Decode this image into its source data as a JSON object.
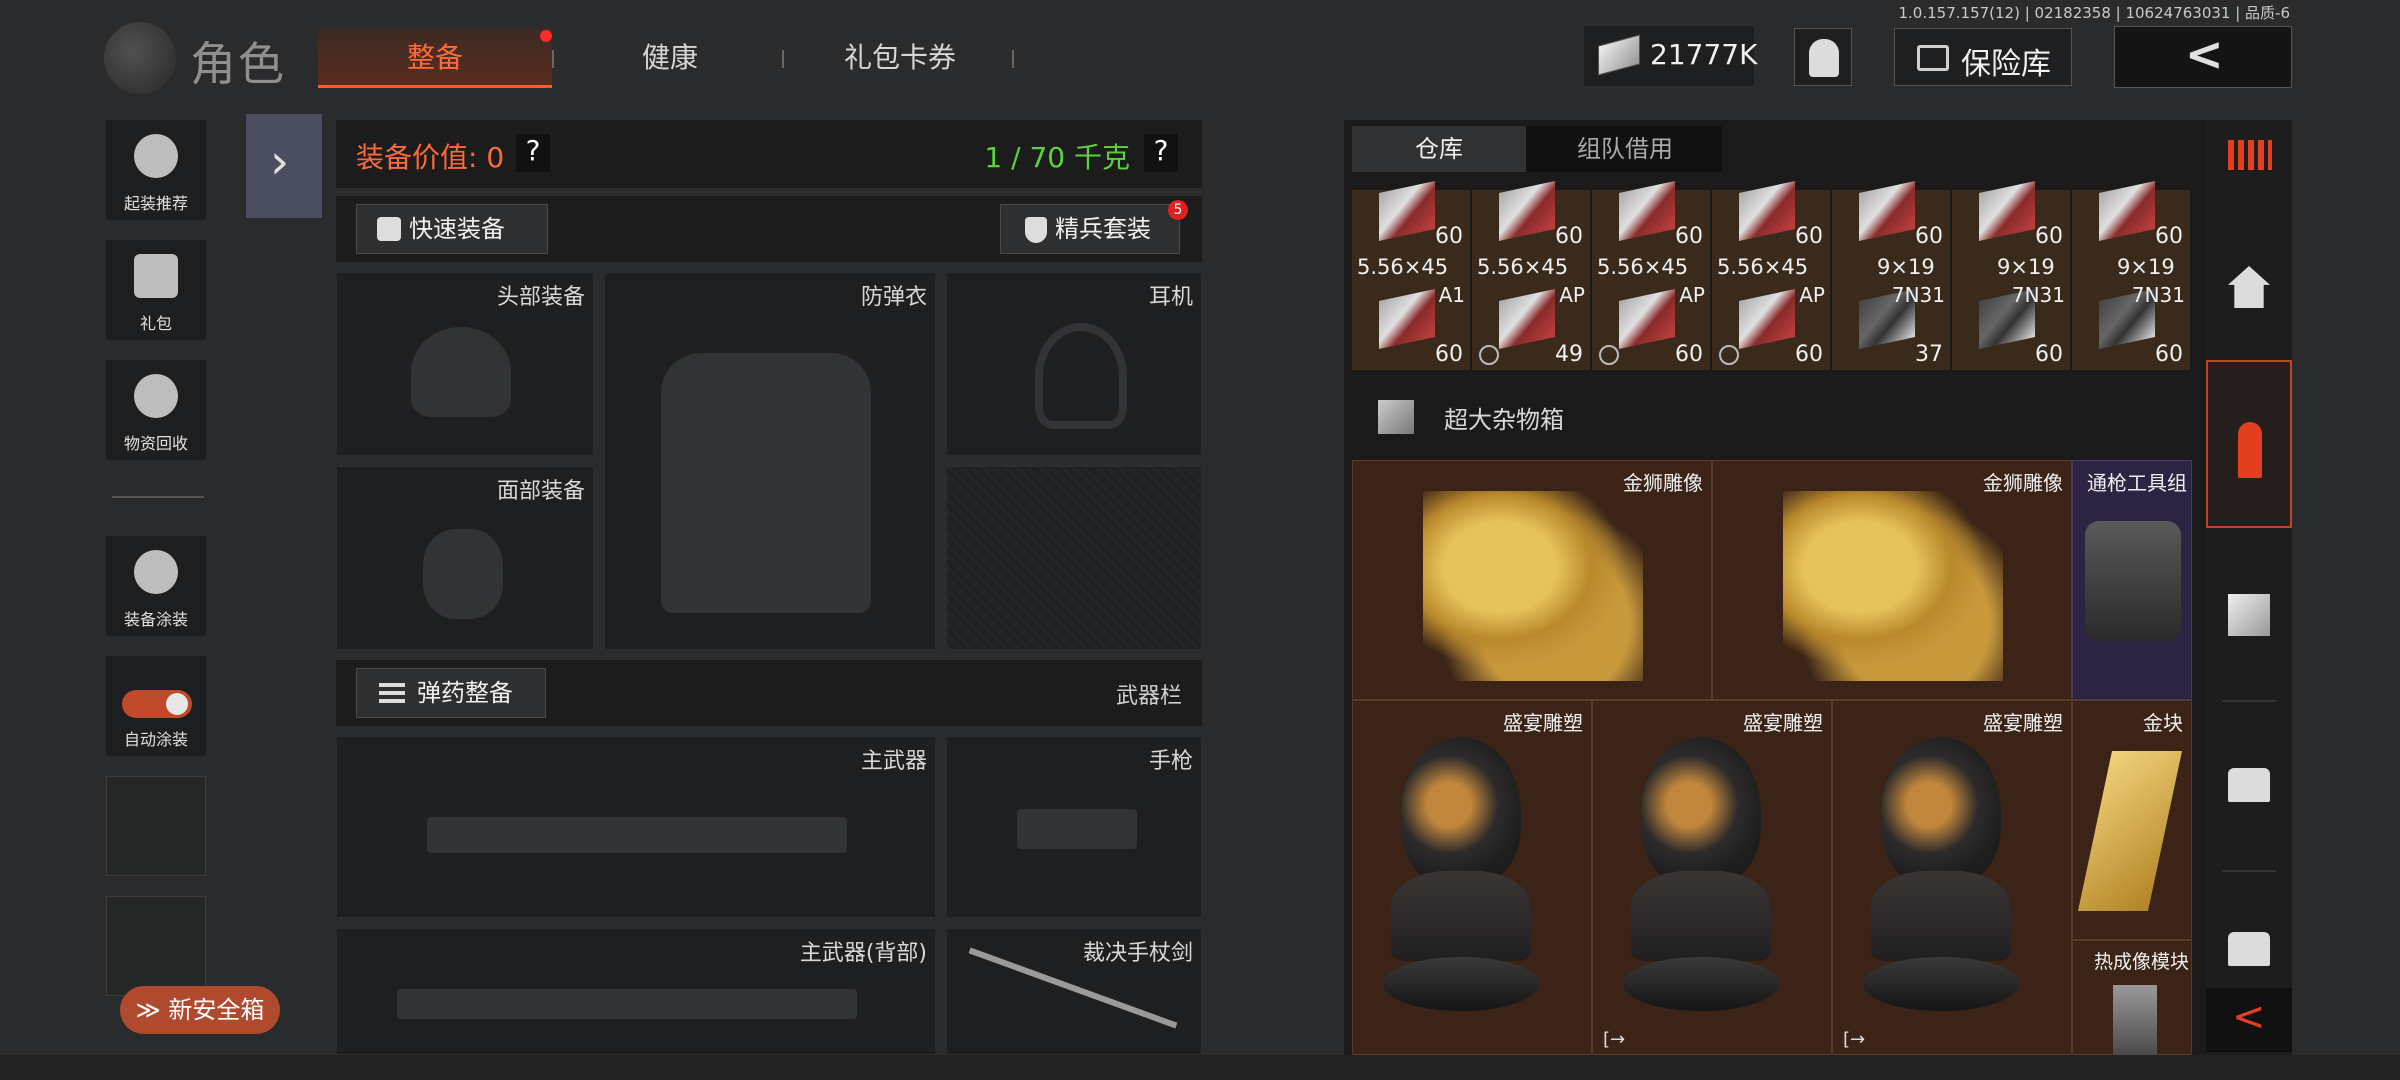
{
  "build_info": "1.0.157.157(12) | 02182358 | 10624763031 | 品质-6",
  "header": {
    "title": "角色",
    "tabs": [
      {
        "label": "整备",
        "active": true
      },
      {
        "label": "健康"
      },
      {
        "label": "礼包卡券"
      }
    ],
    "currency": "21777K",
    "vault_label": "保险库",
    "back_symbol": "<"
  },
  "sidebar": {
    "items": [
      {
        "label": "起装推荐",
        "icon": "helmet-gear-icon"
      },
      {
        "label": "礼包",
        "icon": "gift-icon"
      },
      {
        "label": "物资回收",
        "icon": "recycle-icon"
      },
      {
        "label": "装备涂装",
        "icon": "paint-helmet-icon"
      },
      {
        "label": "自动涂装",
        "icon": "toggle-icon",
        "toggle_on": true
      }
    ],
    "expand_symbol": "›",
    "safe_box_label": "≫ 新安全箱"
  },
  "equipment": {
    "value_label": "装备价值: 0",
    "help": "?",
    "weight": "1 / 70 千克",
    "quick_equip": "快速装备",
    "elite_set": "精兵套装",
    "elite_badge": "5",
    "slots": {
      "head": "头部装备",
      "armor": "防弹衣",
      "headset": "耳机",
      "face": "面部装备",
      "primary": "主武器",
      "pistol": "手枪",
      "primary_back": "主武器(背部)",
      "melee": "裁决手杖剑"
    },
    "ammo_button": "弹药整备",
    "weapon_rail": "武器栏"
  },
  "storage": {
    "tabs": [
      {
        "label": "仓库",
        "active": true
      },
      {
        "label": "组队借用"
      }
    ],
    "top_row_counts": [
      "60",
      "60",
      "60",
      "60",
      "60",
      "60",
      "60"
    ],
    "ammo_row": [
      {
        "name": "5.56×45",
        "type": "A1",
        "count": "60"
      },
      {
        "name": "5.56×45",
        "type": "AP",
        "count": "49"
      },
      {
        "name": "5.56×45",
        "type": "AP",
        "count": "60"
      },
      {
        "name": "5.56×45",
        "type": "AP",
        "count": "60"
      },
      {
        "name": "9×19",
        "type": "7N31",
        "count": "37"
      },
      {
        "name": "9×19",
        "type": "7N31",
        "count": "60"
      },
      {
        "name": "9×19",
        "type": "7N31",
        "count": "60"
      }
    ],
    "crate_label": "超大杂物箱",
    "items": [
      {
        "label": "金狮雕像"
      },
      {
        "label": "金狮雕像"
      },
      {
        "label": "通枪工具组"
      },
      {
        "label": "盛宴雕塑"
      },
      {
        "label": "盛宴雕塑"
      },
      {
        "label": "盛宴雕塑"
      },
      {
        "label": "金块"
      },
      {
        "label": "热成像模块"
      }
    ],
    "exit_mark": "[→"
  },
  "rail": {
    "icons": [
      "grid-menu-icon",
      "home-icon",
      "ammo-icon",
      "crate-icon",
      "container-icon",
      "container-icon"
    ],
    "collapse_symbol": "<"
  },
  "colors": {
    "accent": "#ff6a3a",
    "weight_green": "#5cd33c",
    "item_bg": "#3b2417",
    "rare_bg": "#2d2342"
  }
}
